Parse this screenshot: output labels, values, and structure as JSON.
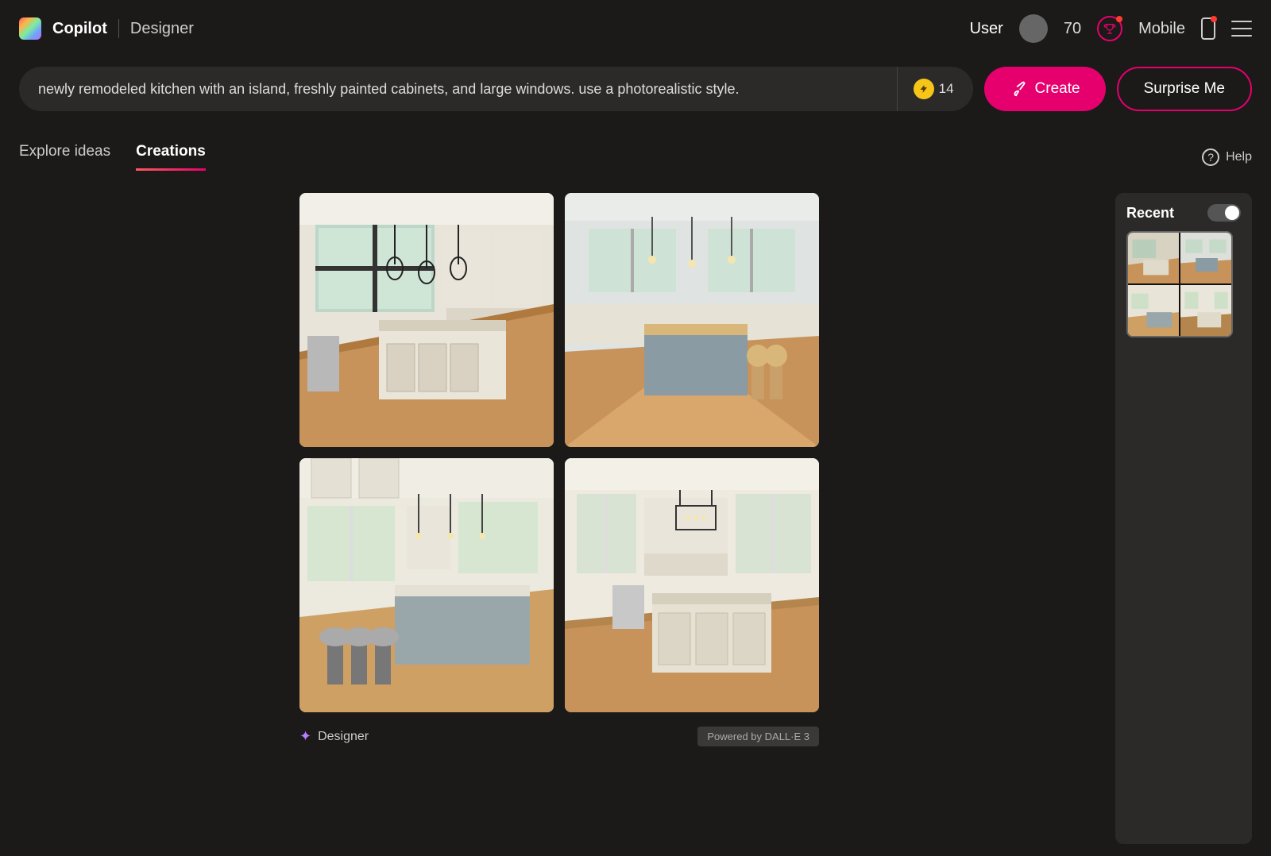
{
  "header": {
    "app_name": "Copilot",
    "app_sub": "Designer",
    "user_label": "User",
    "points": "70",
    "mobile_label": "Mobile"
  },
  "prompt": {
    "text": "newly remodeled kitchen with an island, freshly painted cabinets, and large windows. use a photorealistic style.",
    "boost_count": "14",
    "create_label": "Create",
    "surprise_label": "Surprise Me"
  },
  "tabs": {
    "explore": "Explore ideas",
    "creations": "Creations"
  },
  "help": {
    "label": "Help"
  },
  "gallery": {
    "designer_tag": "Designer",
    "powered_by": "Powered by DALL·E 3"
  },
  "sidebar": {
    "recent_title": "Recent"
  }
}
